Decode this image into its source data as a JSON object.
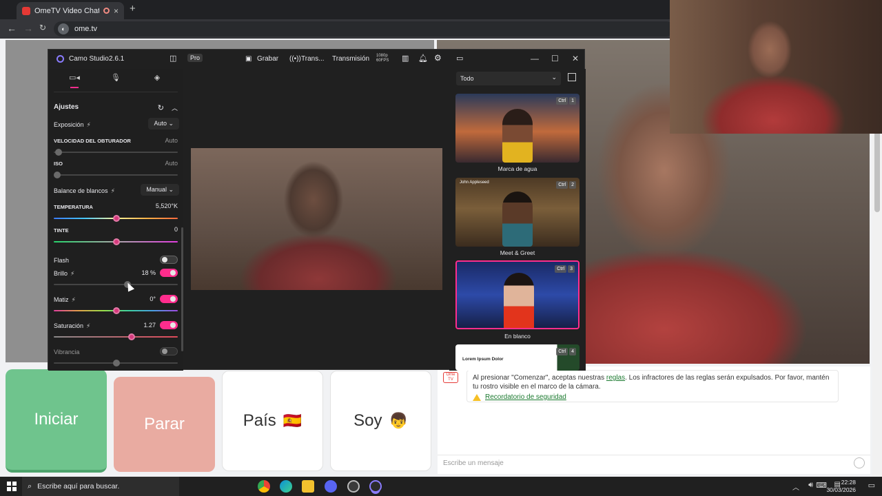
{
  "browser": {
    "tab_title": "OmeTV Video Chat — Om...",
    "tab_close": "×",
    "new_tab": "+",
    "url": "ome.tv"
  },
  "camo": {
    "app_name": "Camo Studio",
    "version": "2.6.1",
    "pro": "Pro",
    "record": "Grabar",
    "trans": "Trans...",
    "broadcast": "Transmisión",
    "res": "1080p",
    "fps": "60FPS",
    "settings_title": "Ajustes",
    "exposure_label": "Exposición",
    "exposure_value": "Auto",
    "shutter_label": "VELOCIDAD DEL OBTURADOR",
    "shutter_value": "Auto",
    "iso_label": "ISO",
    "iso_value": "Auto",
    "wb_label": "Balance de blancos",
    "wb_value": "Manual",
    "temperature_label": "TEMPERATURA",
    "temperature_value": "5,520°K",
    "tint_label": "TINTE",
    "tint_value": "0",
    "flash_label": "Flash",
    "brightness_label": "Brillo",
    "brightness_value": "18 %",
    "hue_label": "Matiz",
    "hue_value": "0°",
    "saturation_label": "Saturación",
    "saturation_value": "1.27",
    "vibrance_label": "Vibrancia",
    "filter": "Todo",
    "scenes": [
      {
        "name": "Marca de agua",
        "ctrl": "Ctrl",
        "num": "1"
      },
      {
        "name": "Meet & Greet",
        "ctrl": "Ctrl",
        "num": "2",
        "caption": "John Appleseed"
      },
      {
        "name": "En blanco",
        "ctrl": "Ctrl",
        "num": "3"
      },
      {
        "name": "",
        "ctrl": "Ctrl",
        "num": "4",
        "caption": "Lorem Ipsum Dolor"
      }
    ]
  },
  "ome": {
    "start": "Iniciar",
    "stop": "Parar",
    "country": "País",
    "country_flag": "🇪🇸",
    "gender": "Soy",
    "gender_emoji": "👦",
    "logo": "Ome TV",
    "notice_before": "Al presionar \"Comenzar\", aceptas nuestras ",
    "notice_link": "reglas",
    "notice_after": ". Los infractores de las reglas serán expulsados. Por favor, mantén tu rostro visible en el marco de la cámara.",
    "safety_link": "Recordatorio de seguridad",
    "message_placeholder": "Escribe un mensaje"
  },
  "taskbar": {
    "search_placeholder": "Escribe aquí para buscar.",
    "time": "22:28",
    "date": "30/03/2026"
  },
  "colors": {
    "accent_pink": "#ff2d8d",
    "start_green": "#6fc48d",
    "stop_salmon": "#e9aba1"
  }
}
